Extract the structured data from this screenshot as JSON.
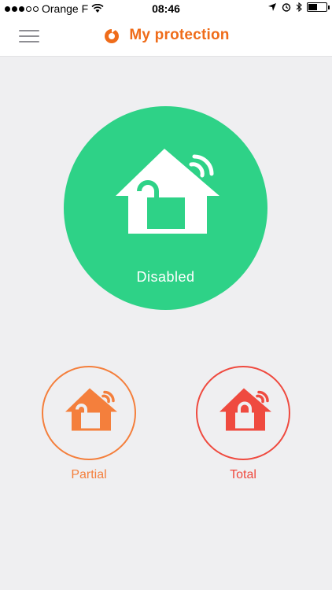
{
  "status_bar": {
    "carrier": "Orange F",
    "time": "08:46",
    "signal_bars_filled": 3,
    "signal_bars_total": 5
  },
  "header": {
    "title": "My protection",
    "accent_color": "#ef6c1a"
  },
  "main_mode": {
    "label": "Disabled",
    "color": "#2ed287"
  },
  "modes": [
    {
      "label": "Partial",
      "color": "#f47f3c"
    },
    {
      "label": "Total",
      "color": "#ef4a3f"
    }
  ],
  "icons": [
    "menu-icon",
    "logo-icon",
    "wifi-icon",
    "location-icon",
    "alarm-icon",
    "bluetooth-icon",
    "battery-icon",
    "house-unlocked-icon",
    "house-locked-icon"
  ]
}
